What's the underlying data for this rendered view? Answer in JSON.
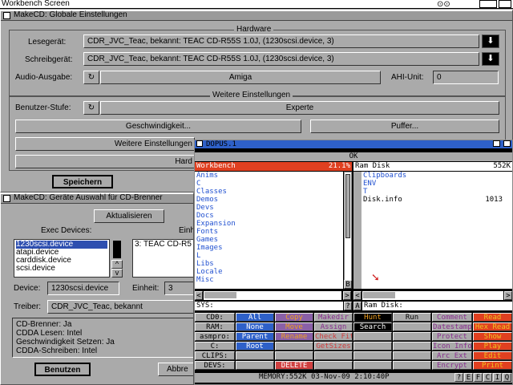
{
  "screen": {
    "title": "Workbench Screen"
  },
  "win1": {
    "title": "MakeCD: Globale Einstellungen",
    "hardware_title": "Hardware",
    "lesegeraet_label": "Lesegerät:",
    "lesegeraet_value": "CDR_JVC_Teac, bekannt: TEAC CD-R55S 1.0J, (1230scsi.device, 3)",
    "schreibgeraet_label": "Schreibgerät:",
    "schreibgeraet_value": "CDR_JVC_Teac, bekannt: TEAC CD-R55S 1.0J, (1230scsi.device, 3)",
    "audio_label": "Audio-Ausgabe:",
    "audio_value": "Amiga",
    "ahi_label": "AHI-Unit:",
    "ahi_value": "0",
    "weitere_title": "Weitere Einstellungen",
    "benutzer_label": "Benutzer-Stufe:",
    "benutzer_value": "Experte",
    "geschwindigkeit_btn": "Geschwindigkeit...",
    "puffer_btn": "Puffer...",
    "weitere_btn": "Weitere Einstellungen",
    "hard_btn": "Hard",
    "speichern_btn": "Speichern"
  },
  "win2": {
    "title": "MakeCD: Geräte Auswahl für CD-Brenner",
    "aktualisieren_btn": "Aktualisieren",
    "exec_label": "Exec Devices:",
    "einheit_top_label": "Einheit",
    "exec_items": [
      "1230scsi.device",
      "atapi.device",
      "carddisk.device",
      "scsi.device"
    ],
    "unit_items": [
      "3: TEAC CD-R5"
    ],
    "device_label": "Device:",
    "device_value": "1230scsi.device",
    "einheit_label": "Einheit:",
    "einheit_value": "3",
    "treiber_label": "Treiber:",
    "treiber_value": "CDR_JVC_Teac, bekannt",
    "info_lines": [
      "CD-Brenner: Ja",
      "CDDA Lesen: Intel",
      "Geschwindigkeit Setzen: Ja",
      "CDDA-Schreiben: Intel"
    ],
    "benutzen_btn": "Benutzen",
    "abbrechen_btn": "Abbre"
  },
  "dopus": {
    "title": "DOPUS.1",
    "ok": "OK",
    "left_head": "Workbench",
    "left_size": "21.1%",
    "right_head": "Ram Disk",
    "right_size": "552K",
    "left_files": [
      "Anims",
      "C",
      "Classes",
      "Demos",
      "Devs",
      "Docs",
      "Expansion",
      "Fonts",
      "Games",
      "Images",
      "L",
      "Libs",
      "Locale",
      "Misc"
    ],
    "right_dirs": [
      "Clipboards",
      "ENV",
      "T"
    ],
    "right_file_name": "Disk.info",
    "right_file_size": "1013",
    "left_path": "SYS:",
    "right_path": "Ram Disk:",
    "mid_b": "B",
    "mid_r": "R",
    "mid_s": "S",
    "mid_a": "A",
    "mid_lt": "<",
    "mid_gt": ">",
    "mid_q": "?",
    "devices": [
      "CD0:",
      "RAM:",
      "asmpro:",
      "C:",
      "CLIPS:",
      "DEVS:"
    ],
    "col1": [
      "All",
      "None",
      "Parent",
      "Root"
    ],
    "col2": [
      "Copy",
      "Move",
      "Rename",
      "",
      "",
      "DELETE"
    ],
    "col3": [
      "Makedir",
      "Assign",
      "Check Fit",
      "GetSizes"
    ],
    "col4": [
      "Hunt",
      "Search"
    ],
    "col5": [
      "Run"
    ],
    "col6": [
      "Comment",
      "Datestamp",
      "Protect",
      "Icon Info",
      "Arc Ext",
      "Encrypt"
    ],
    "col7": [
      "Read",
      "Hex Read",
      "Show",
      "Play",
      "Edit",
      "Print"
    ],
    "status": "MEMORY:552K  03-Nov-09   2:10:40P",
    "flags": [
      "?",
      "E",
      "F",
      "C",
      "I",
      "Q"
    ]
  }
}
